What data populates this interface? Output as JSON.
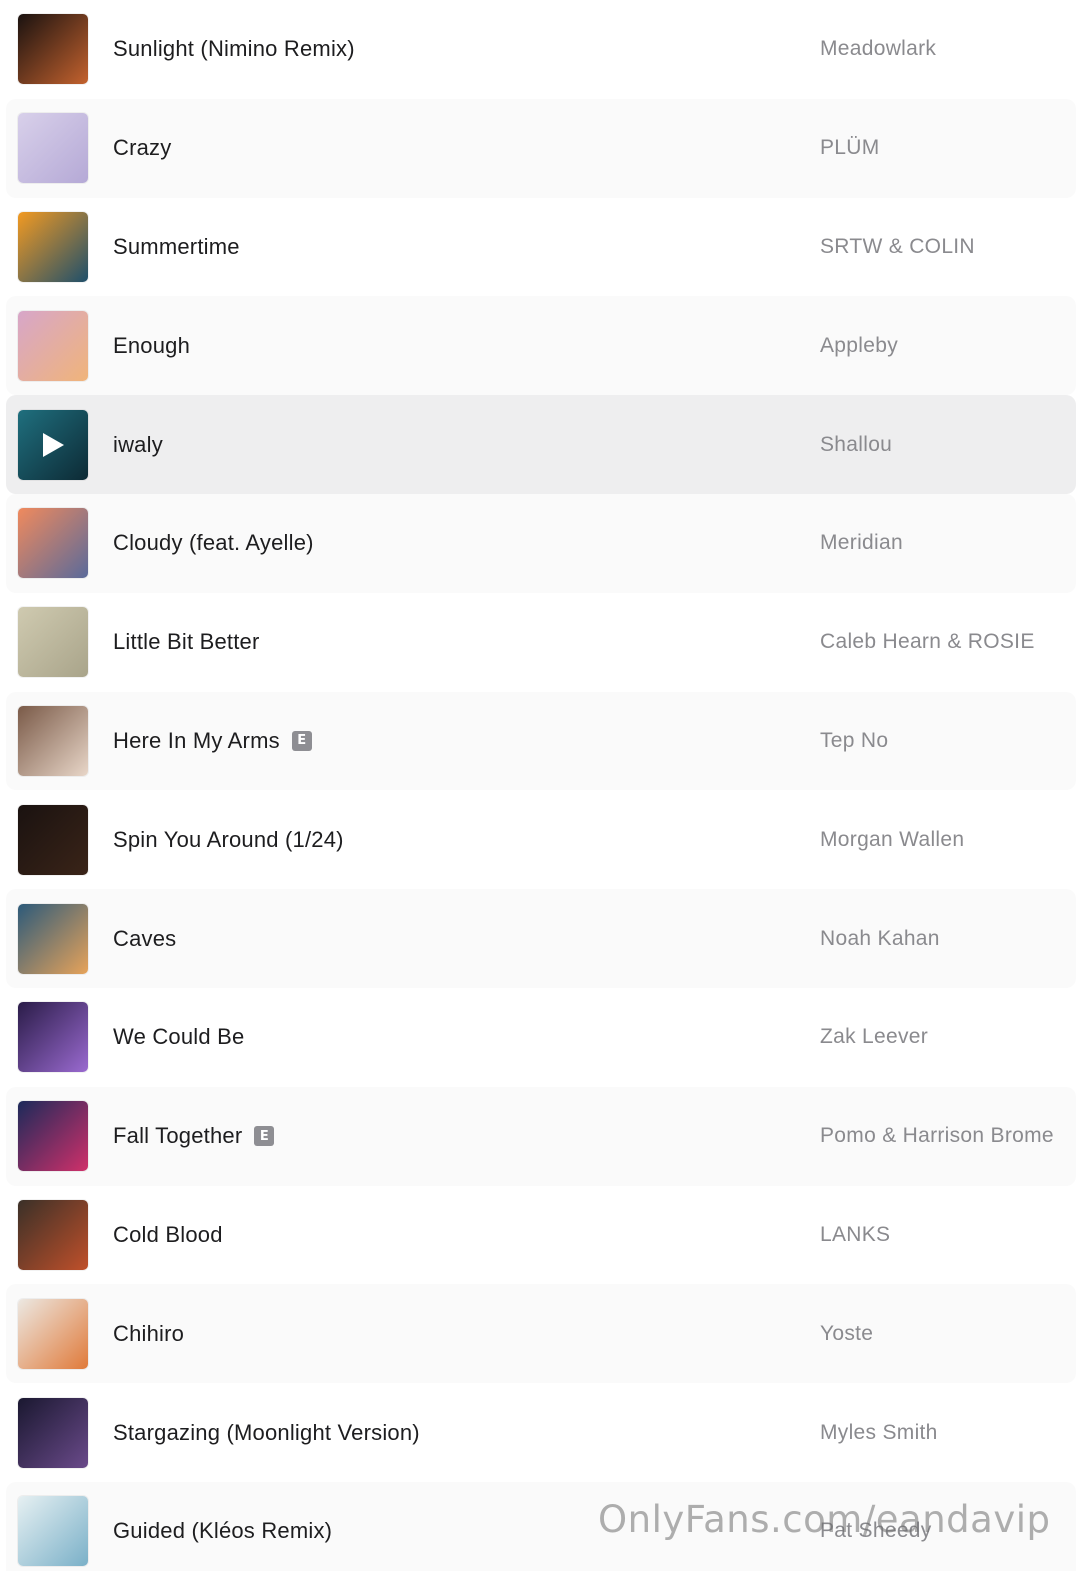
{
  "tracks": [
    {
      "title": "Sunlight (Nimino Remix)",
      "artist": "Meadowlark",
      "explicit": false
    },
    {
      "title": "Crazy",
      "artist": "PLÜM",
      "explicit": false
    },
    {
      "title": "Summertime",
      "artist": "SRTW & COLIN",
      "explicit": false
    },
    {
      "title": "Enough",
      "artist": "Appleby",
      "explicit": false
    },
    {
      "title": "iwaly",
      "artist": "Shallou",
      "explicit": false,
      "playing": true
    },
    {
      "title": "Cloudy (feat. Ayelle)",
      "artist": "Meridian",
      "explicit": false
    },
    {
      "title": "Little Bit Better",
      "artist": "Caleb Hearn & ROSIE",
      "explicit": false
    },
    {
      "title": "Here In My Arms",
      "artist": "Tep No",
      "explicit": true
    },
    {
      "title": "Spin You Around (1/24)",
      "artist": "Morgan Wallen",
      "explicit": false
    },
    {
      "title": "Caves",
      "artist": "Noah Kahan",
      "explicit": false
    },
    {
      "title": "We Could Be",
      "artist": "Zak Leever",
      "explicit": false
    },
    {
      "title": "Fall Together",
      "artist": "Pomo & Harrison Brome",
      "explicit": true
    },
    {
      "title": "Cold Blood",
      "artist": "LANKS",
      "explicit": false
    },
    {
      "title": "Chihiro",
      "artist": "Yoste",
      "explicit": false
    },
    {
      "title": "Stargazing (Moonlight Version)",
      "artist": "Myles Smith",
      "explicit": false
    },
    {
      "title": "Guided (Kléos Remix)",
      "artist": "Pat Sheedy",
      "explicit": false
    }
  ],
  "explicit_label": "E",
  "watermark": "OnlyFans.com/eandavip",
  "artwork_colors": [
    [
      "#1a1210",
      "#c4622e"
    ],
    [
      "#d8d0ea",
      "#b5a9d6"
    ],
    [
      "#f29a22",
      "#1e4f6b"
    ],
    [
      "#d7a6c9",
      "#f0b47a"
    ],
    [
      "#1f6f7e",
      "#0d2a35"
    ],
    [
      "#f08a5d",
      "#5a6a9a"
    ],
    [
      "#cfcab0",
      "#a9a48a"
    ],
    [
      "#7a5a48",
      "#e8d6c8"
    ],
    [
      "#1a1210",
      "#3a2418"
    ],
    [
      "#2c5a7a",
      "#e7a35a"
    ],
    [
      "#2a1c48",
      "#9a6ad0"
    ],
    [
      "#1c2a5a",
      "#d0306a"
    ],
    [
      "#3a3028",
      "#c0502a"
    ],
    [
      "#ece8e2",
      "#e07a3a"
    ],
    [
      "#1a1830",
      "#6a4a8a"
    ],
    [
      "#e6f0f2",
      "#7ab0c8"
    ]
  ],
  "icons": {
    "playing": "play-icon",
    "explicit": "explicit-badge"
  }
}
